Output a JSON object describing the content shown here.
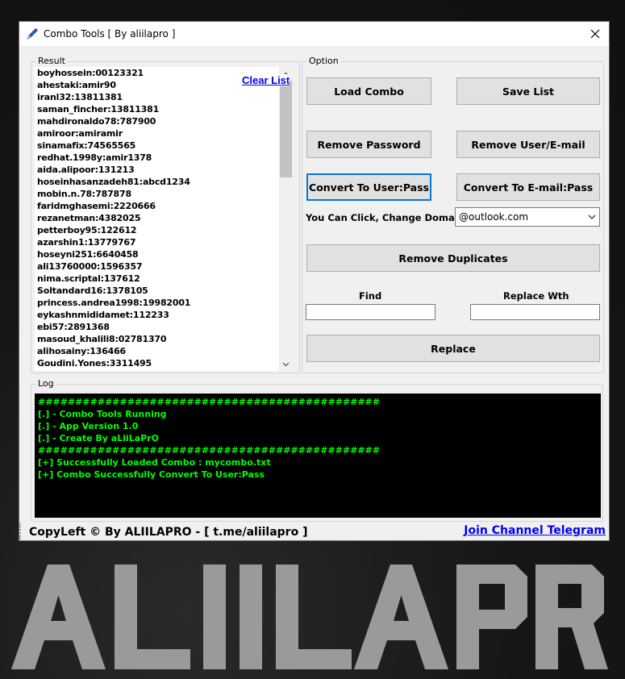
{
  "window": {
    "title": "Combo Tools [ By aliilapro ]"
  },
  "result": {
    "legend": "Result",
    "clear_label": "Clear List",
    "items": [
      "boyhossein:00123321",
      "ahestaki:amir90",
      "iranl32:13811381",
      "saman_fincher:13811381",
      "mahdironaldo78:787900",
      "amiroor:amiramir",
      "sinamafix:74565565",
      "redhat.1998y:amir1378",
      "aida.alipoor:131213",
      "hoseinhasanzadeh81:abcd1234",
      "mobin.n.78:787878",
      "faridmghasemi:2220666",
      "rezanetman:4382025",
      "petterboy95:122612",
      "azarshin1:13779767",
      "hoseyni251:6640458",
      "ali13760000:1596357",
      "nima.scriptal:137612",
      "Soltandard16:1378105",
      "princess.andrea1998:19982001",
      "eykashnmididamet:112233",
      "ebi57:2891368",
      "masoud_khalili8:02781370",
      "alihosainy:136466",
      "Goudini.Yones:3311495"
    ]
  },
  "option": {
    "legend": "Option",
    "load_combo": "Load Combo",
    "save_list": "Save List",
    "remove_password": "Remove Password",
    "remove_user_email": "Remove User/E-mail",
    "convert_user_pass": "Convert To User:Pass",
    "convert_email_pass": "Convert To E-mail:Pass",
    "domain_label": "You Can Click, Change Domain",
    "domain_value": "@outlook.com",
    "remove_duplicates": "Remove Duplicates",
    "find_label": "Find",
    "replace_with_label": "Replace Wth",
    "find_value": "",
    "replace_value": "",
    "replace_button": "Replace"
  },
  "log": {
    "legend": "Log",
    "lines": [
      "##############################################",
      "[.] - Combo Tools Running",
      "[.] - App Version 1.0",
      "[.] - Create By aLiiLaPrO",
      "##############################################",
      "[+] Successfully Loaded Combo : mycombo.txt",
      "[+] Combo Successfully Convert To User:Pass"
    ]
  },
  "footer": {
    "copyleft": "CopyLeft ©  By ALIILAPRO - [ t.me/aliilapro ]",
    "telegram_link": "Join Channel Telegram"
  },
  "banner": {
    "logo_text": "ALIILAPRO"
  },
  "colors": {
    "console_bg": "#000000",
    "console_text": "#00ff00",
    "link": "#0000ee",
    "focus": "#0078d7"
  }
}
